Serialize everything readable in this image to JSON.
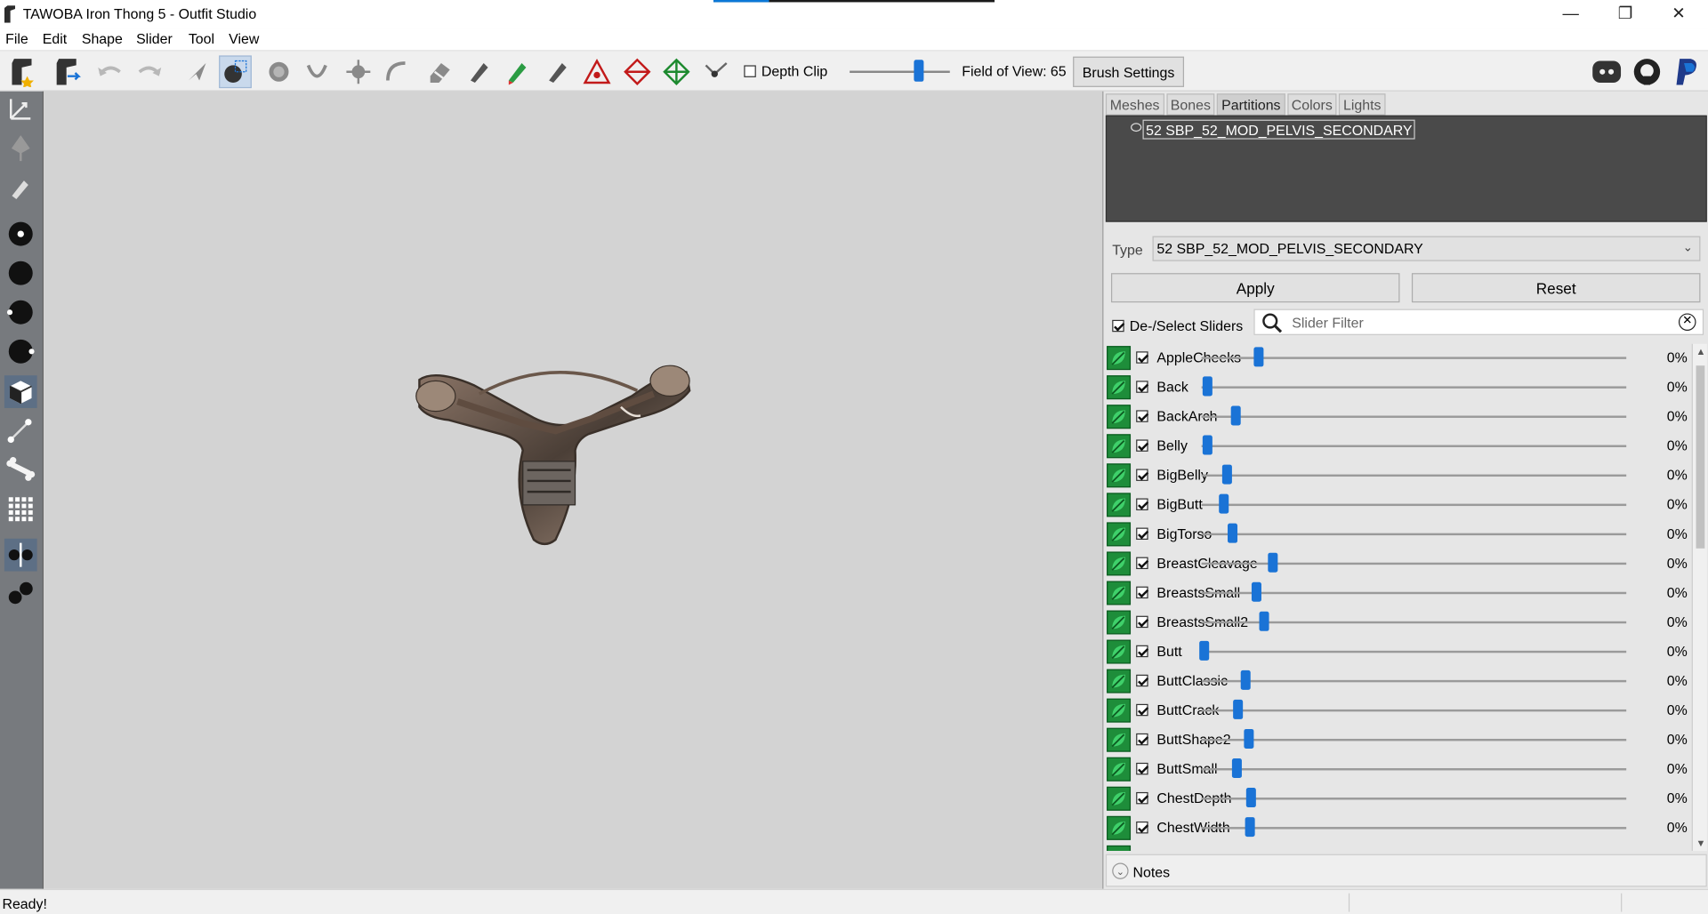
{
  "window": {
    "title": "TAWOBA Iron Thong 5 - Outfit Studio",
    "controls": [
      "minimize-icon",
      "restore-icon",
      "close-icon"
    ]
  },
  "menu": [
    "File",
    "Edit",
    "Shape",
    "Slider",
    "Tool",
    "View"
  ],
  "toolbar": {
    "depth_clip_label": "Depth Clip",
    "depth_clip_checked": false,
    "field_of_view_label": "Field of View: 65",
    "field_of_view_value": 65,
    "brush_settings_label": "Brush Settings",
    "social_icons": [
      "discord-icon",
      "github-icon",
      "paypal-icon"
    ]
  },
  "right_panel": {
    "tabs": [
      "Meshes",
      "Bones",
      "Partitions",
      "Colors",
      "Lights"
    ],
    "active_tab": "Partitions",
    "partition_item": "52 SBP_52_MOD_PELVIS_SECONDARY",
    "type_label": "Type",
    "type_value": "52 SBP_52_MOD_PELVIS_SECONDARY",
    "apply_label": "Apply",
    "reset_label": "Reset",
    "deselect_label": "De-/Select Sliders",
    "deselect_checked": true,
    "filter_placeholder": "Slider Filter",
    "sliders": [
      {
        "name": "AppleCheeks",
        "value": "0%"
      },
      {
        "name": "Back",
        "value": "0%"
      },
      {
        "name": "BackArch",
        "value": "0%"
      },
      {
        "name": "Belly",
        "value": "0%"
      },
      {
        "name": "BigBelly",
        "value": "0%"
      },
      {
        "name": "BigButt",
        "value": "0%"
      },
      {
        "name": "BigTorso",
        "value": "0%"
      },
      {
        "name": "BreastCleavage",
        "value": "0%"
      },
      {
        "name": "BreastsSmall",
        "value": "0%"
      },
      {
        "name": "BreastsSmall2",
        "value": "0%"
      },
      {
        "name": "Butt",
        "value": "0%"
      },
      {
        "name": "ButtClassic",
        "value": "0%"
      },
      {
        "name": "ButtCrack",
        "value": "0%"
      },
      {
        "name": "ButtShape2",
        "value": "0%"
      },
      {
        "name": "ButtSmall",
        "value": "0%"
      },
      {
        "name": "ChestDepth",
        "value": "0%"
      },
      {
        "name": "ChestWidth",
        "value": "0%"
      }
    ],
    "notes_label": "Notes"
  },
  "status": {
    "text": "Ready!"
  },
  "colors": {
    "accent": "#1a73d6",
    "slider_leaf": "#1e8d3a",
    "viewport_bg": "#d3d3d3",
    "tree_bg": "#4a4a4a"
  }
}
